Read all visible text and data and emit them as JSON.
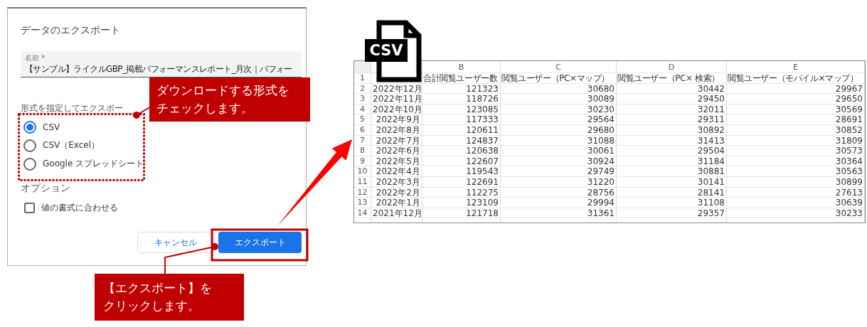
{
  "dialog": {
    "title": "データのエクスポート",
    "name_field": {
      "label": "名前 *",
      "value": "【サンプル】ライクルGBP_掲載パフォーマンスレポート_月次｜パフォー"
    },
    "format_heading": "形式を指定してエクスポー",
    "formats": [
      {
        "label": "CSV",
        "selected": true
      },
      {
        "label": "CSV（Excel）",
        "selected": false
      },
      {
        "label": "Google スプレッドシート",
        "selected": false
      }
    ],
    "options_heading": "オプション",
    "options": [
      {
        "label": "値の書式に合わせる",
        "checked": false
      }
    ],
    "buttons": [
      {
        "label": "キャンセル",
        "kind": "secondary"
      },
      {
        "label": "エクスポート",
        "kind": "primary"
      }
    ]
  },
  "callouts": [
    {
      "text": "ダウンロードする形式をチェックします。"
    },
    {
      "text": "【エクスポート】をクリックします。"
    }
  ],
  "file_badge": "CSV",
  "sheet": {
    "columns": [
      {
        "letter": "B",
        "heading": "合計閲覧ユーザー数"
      },
      {
        "letter": "C",
        "heading": "閲覧ユーザー（PC×マップ）"
      },
      {
        "letter": "D",
        "heading": "閲覧ユーザー（PC× 検索）"
      },
      {
        "letter": "E",
        "heading": "閲覧ユーザー（モバイル×マップ）"
      }
    ],
    "heading_row_number": "1",
    "rows": [
      {
        "number": "2",
        "month": "2022年12月",
        "values": [
          "121323",
          "30680",
          "30442",
          "29967"
        ]
      },
      {
        "number": "3",
        "month": "2022年11月",
        "values": [
          "118726",
          "30089",
          "29450",
          "29650"
        ]
      },
      {
        "number": "4",
        "month": "2022年10月",
        "values": [
          "123085",
          "30230",
          "32011",
          "30569"
        ]
      },
      {
        "number": "5",
        "month": "2022年9月",
        "values": [
          "117333",
          "29564",
          "29311",
          "28691"
        ]
      },
      {
        "number": "6",
        "month": "2022年8月",
        "values": [
          "120611",
          "29680",
          "30892",
          "30852"
        ]
      },
      {
        "number": "7",
        "month": "2022年7月",
        "values": [
          "124837",
          "31088",
          "31413",
          "31809"
        ]
      },
      {
        "number": "8",
        "month": "2022年6月",
        "values": [
          "120638",
          "30061",
          "29504",
          "30573"
        ]
      },
      {
        "number": "9",
        "month": "2022年5月",
        "values": [
          "122607",
          "30924",
          "31184",
          "30364"
        ]
      },
      {
        "number": "10",
        "month": "2022年4月",
        "values": [
          "119543",
          "29749",
          "30881",
          "30563"
        ]
      },
      {
        "number": "11",
        "month": "2022年3月",
        "values": [
          "122691",
          "31220",
          "30141",
          "30899"
        ]
      },
      {
        "number": "12",
        "month": "2022年2月",
        "values": [
          "112275",
          "28756",
          "28141",
          "27613"
        ]
      },
      {
        "number": "13",
        "month": "2022年1月",
        "values": [
          "123109",
          "29994",
          "31108",
          "30639"
        ]
      },
      {
        "number": "14",
        "month": "2021年12月",
        "values": [
          "121718",
          "31361",
          "29357",
          "30233"
        ]
      }
    ]
  }
}
